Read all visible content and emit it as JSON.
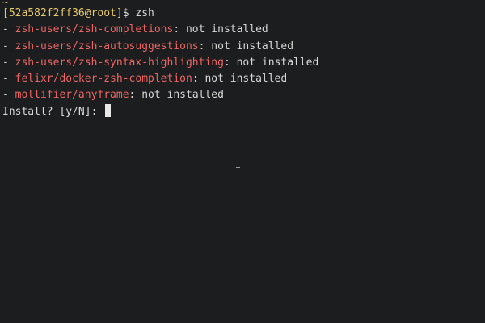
{
  "top_marker": "~",
  "prompt": {
    "host": "[52a582f2ff36@root]",
    "symbol": "$",
    "command": "zsh"
  },
  "packages": [
    {
      "bullet": "- ",
      "name": "zsh-users/zsh-completions",
      "status": ": not installed"
    },
    {
      "bullet": "- ",
      "name": "zsh-users/zsh-autosuggestions",
      "status": ": not installed"
    },
    {
      "bullet": "- ",
      "name": "zsh-users/zsh-syntax-highlighting",
      "status": ": not installed"
    },
    {
      "bullet": "- ",
      "name": "felixr/docker-zsh-completion",
      "status": ": not installed"
    },
    {
      "bullet": "- ",
      "name": "mollifier/anyframe",
      "status": ": not installed"
    }
  ],
  "install_prompt": "Install? [y/N]: ",
  "colors": {
    "background": "#1b1d1e",
    "text": "#d8d8d8",
    "package_name": "#ef6565",
    "prompt": "#e6c96a"
  },
  "icons": {
    "mouse_pointer": "text-cursor-ibeam-icon"
  }
}
